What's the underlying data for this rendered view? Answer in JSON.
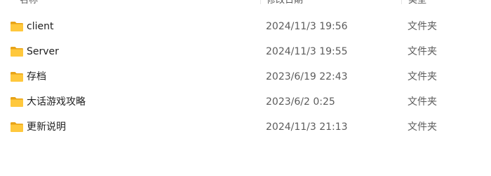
{
  "columns": {
    "name": "名称",
    "date": "修改日期",
    "type": "类型"
  },
  "rows": [
    {
      "name": "client",
      "date": "2024/11/3 19:56",
      "type": "文件夹",
      "icon": "folder-icon"
    },
    {
      "name": "Server",
      "date": "2024/11/3 19:55",
      "type": "文件夹",
      "icon": "folder-icon"
    },
    {
      "name": "存档",
      "date": "2023/6/19 22:43",
      "type": "文件夹",
      "icon": "folder-icon"
    },
    {
      "name": "大话游戏攻略",
      "date": "2023/6/2 0:25",
      "type": "文件夹",
      "icon": "folder-icon"
    },
    {
      "name": "更新说明",
      "date": "2024/11/3 21:13",
      "type": "文件夹",
      "icon": "folder-icon"
    }
  ],
  "colors": {
    "folder_body": "#ffc83d",
    "folder_tab": "#e8a317",
    "secondary_text": "#5c5c5c"
  }
}
